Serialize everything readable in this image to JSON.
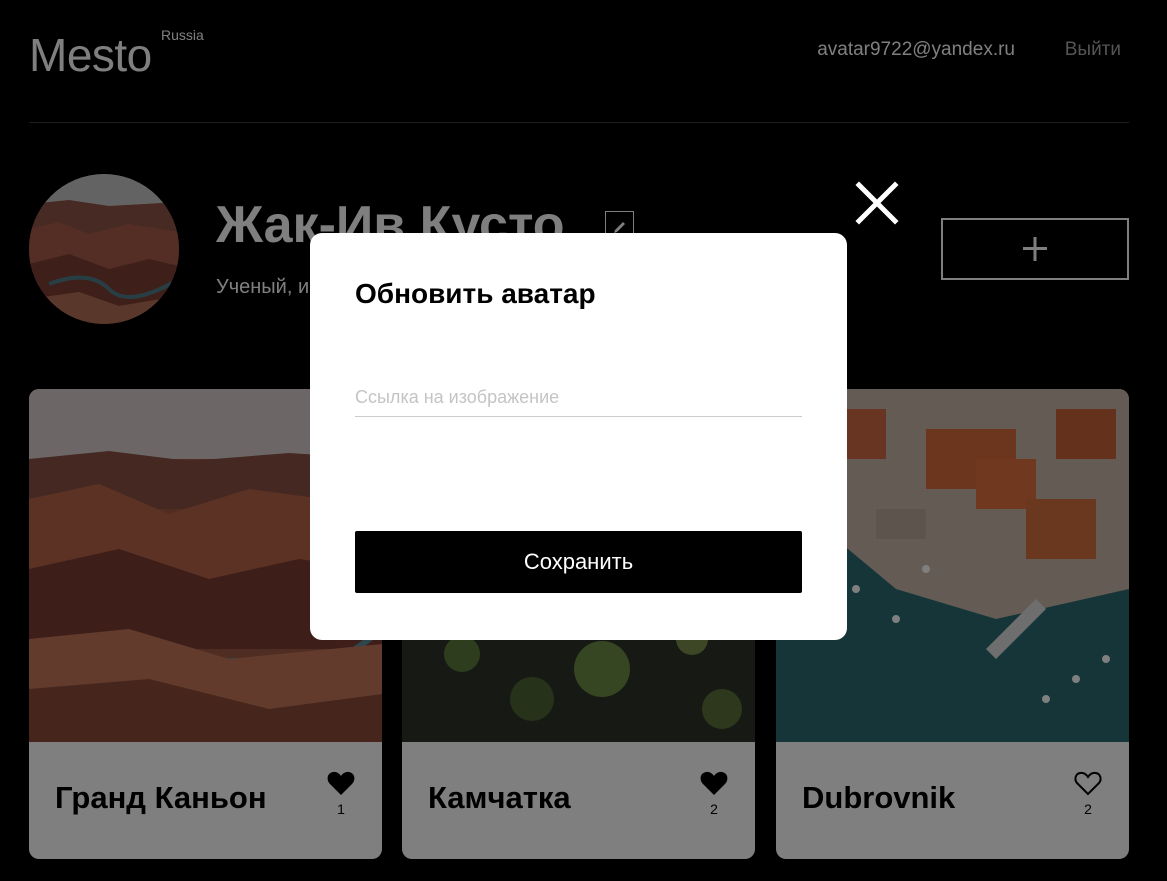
{
  "header": {
    "logo": "Mesto",
    "logo_sub": "Russia",
    "email": "avatar9722@yandex.ru",
    "logout_label": "Выйти"
  },
  "profile": {
    "name": "Жак-Ив Кусто",
    "about": "Ученый, исследователь океана",
    "add_button_icon": "plus-icon",
    "edit_button_icon": "pencil-icon"
  },
  "cards": [
    {
      "title": "Гранд Каньон",
      "likes": "1",
      "liked": true
    },
    {
      "title": "Камчатка",
      "likes": "2",
      "liked": true
    },
    {
      "title": "Dubrovnik",
      "likes": "2",
      "liked": false
    }
  ],
  "popup": {
    "title": "Обновить аватар",
    "input_placeholder": "Ссылка на изображение",
    "input_value": "",
    "save_label": "Сохранить",
    "close_icon": "close-icon"
  },
  "colors": {
    "background": "#000000",
    "text_muted": "#a9a9a9",
    "card_background": "#ffffff",
    "button_primary": "#000000"
  }
}
